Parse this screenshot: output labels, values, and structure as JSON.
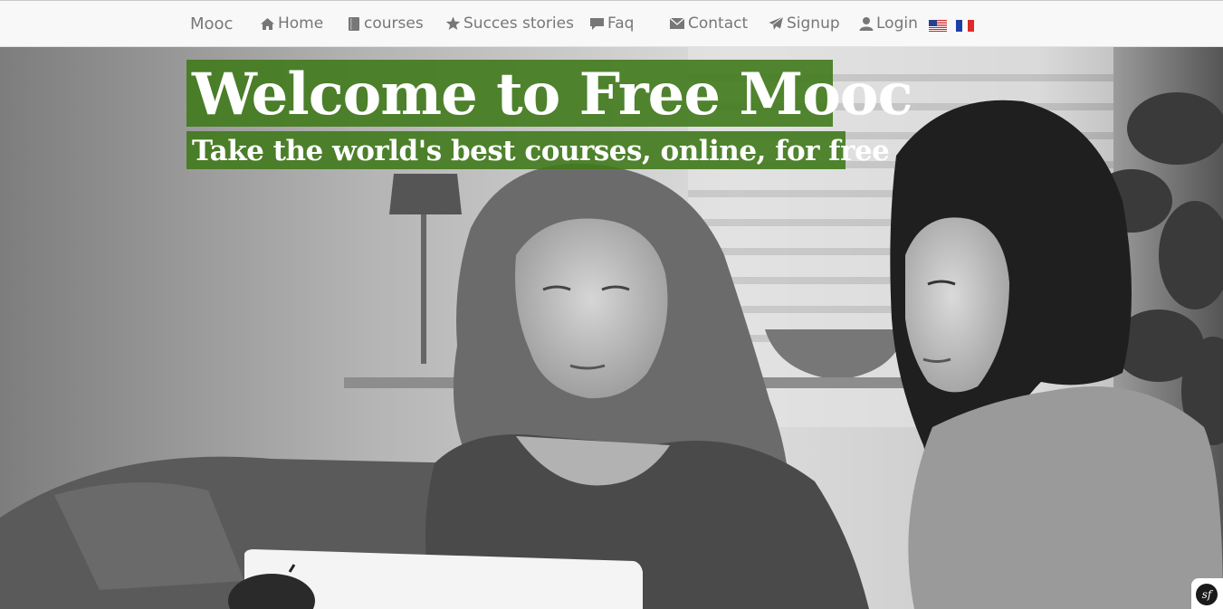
{
  "navbar": {
    "brand": "Mooc",
    "items": [
      {
        "label": "Home",
        "icon": "home-icon"
      },
      {
        "label": "courses",
        "icon": "book-icon"
      },
      {
        "label": "Succes stories",
        "icon": "star-icon"
      },
      {
        "label": "Faq",
        "icon": "comment-icon"
      },
      {
        "label": "Contact",
        "icon": "envelope-icon"
      },
      {
        "label": "Signup",
        "icon": "send-icon"
      },
      {
        "label": "Login",
        "icon": "user-icon"
      }
    ],
    "languages": [
      {
        "code": "en",
        "icon": "us-flag-icon"
      },
      {
        "code": "fr",
        "icon": "fr-flag-icon"
      }
    ]
  },
  "hero": {
    "headline": "Welcome to Free Mooc",
    "subheadline": "Take the world's best courses, online, for free",
    "accent_color": "#407a1c"
  },
  "toolbar_badge": {
    "label": "sf",
    "icon": "symfony-icon"
  }
}
